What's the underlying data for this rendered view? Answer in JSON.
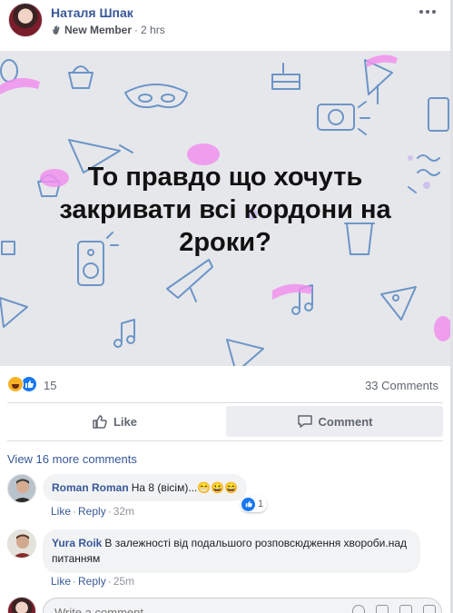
{
  "post": {
    "author": "Наталя Шпак",
    "badge": "New Member",
    "separator": "·",
    "time": "2 hrs",
    "banner_text": "То правдо що хочуть закривати всі кордони на 2роки?"
  },
  "reactions": {
    "count": "15",
    "comments": "33 Comments"
  },
  "actions": {
    "like": "Like",
    "comment": "Comment"
  },
  "comments": {
    "view_more": "View 16 more comments",
    "items": [
      {
        "name": "Roman Roman",
        "text": "На 8 (вісім)...😁😀😄",
        "like": "Like",
        "reply": "Reply",
        "time": "32m",
        "reaction_count": "1"
      },
      {
        "name": "Yura Roik",
        "text": "В залежності від подальшого розповсюдження хвороби.над питанням",
        "like": "Like",
        "reply": "Reply",
        "time": "25m"
      }
    ]
  },
  "composer": {
    "placeholder": "Write a comment..."
  },
  "colors": {
    "link": "#385898",
    "banner_bg": "#e6e7ea",
    "like_blue": "#1877f2"
  }
}
